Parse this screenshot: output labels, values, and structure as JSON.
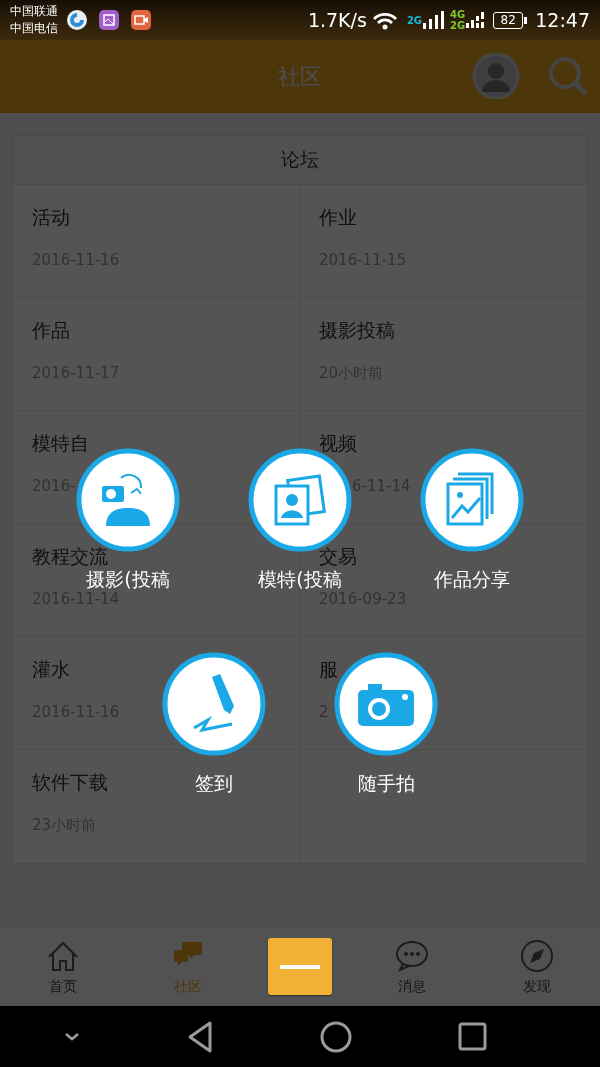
{
  "status_bar": {
    "carriers": [
      "中国联通",
      "中国电信"
    ],
    "speed": "1.7K/s",
    "sim1_network": "2G",
    "sim2_networks": [
      "4G",
      "2G"
    ],
    "battery": "82",
    "time": "12:47"
  },
  "header": {
    "title": "社区"
  },
  "forum": {
    "title": "论坛",
    "boards": [
      {
        "name": "活动",
        "updated": "2016-11-16"
      },
      {
        "name": "作业",
        "updated": "2016-11-15"
      },
      {
        "name": "作品",
        "updated": "2016-11-17"
      },
      {
        "name": "摄影投稿",
        "updated": "20小时前"
      },
      {
        "name": "模特自",
        "updated": "2016-"
      },
      {
        "name": "视频",
        "updated": "6-11-14"
      },
      {
        "name": "教程交流",
        "updated": "2016-11-14"
      },
      {
        "name": "交易",
        "updated": "2016-09-23"
      },
      {
        "name": "灌水",
        "updated": "2016-11-16"
      },
      {
        "name": "服",
        "updated": "2"
      },
      {
        "name": "软件下载",
        "updated": "23小时前"
      }
    ]
  },
  "popup_menu": {
    "items": [
      {
        "label": "摄影(投稿"
      },
      {
        "label": "模特(投稿"
      },
      {
        "label": "作品分享"
      },
      {
        "label": "签到"
      },
      {
        "label": "随手拍"
      }
    ]
  },
  "tab_bar": {
    "tabs": [
      {
        "label": "首页",
        "selected": false
      },
      {
        "label": "社区",
        "selected": true
      },
      {
        "label": "消息",
        "selected": false
      },
      {
        "label": "发现",
        "selected": false
      }
    ]
  }
}
